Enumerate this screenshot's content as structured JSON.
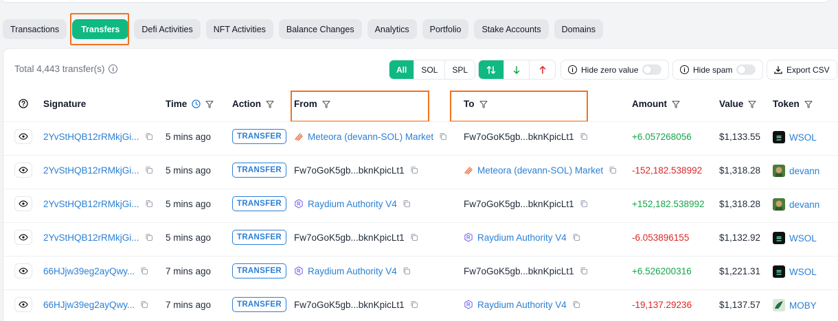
{
  "tabs": [
    {
      "label": "Transactions",
      "active": false
    },
    {
      "label": "Transfers",
      "active": true
    },
    {
      "label": "Defi Activities",
      "active": false
    },
    {
      "label": "NFT Activities",
      "active": false
    },
    {
      "label": "Balance Changes",
      "active": false
    },
    {
      "label": "Analytics",
      "active": false
    },
    {
      "label": "Portfolio",
      "active": false
    },
    {
      "label": "Stake Accounts",
      "active": false
    },
    {
      "label": "Domains",
      "active": false
    }
  ],
  "summary": {
    "total_text": "Total 4,443 transfer(s)"
  },
  "toolbar": {
    "type_filter": [
      "All",
      "SOL",
      "SPL"
    ],
    "type_selected": "All",
    "hide_zero_label": "Hide zero value",
    "hide_spam_label": "Hide spam",
    "export_label": "Export CSV"
  },
  "columns": {
    "signature": "Signature",
    "time": "Time",
    "action": "Action",
    "from": "From",
    "to": "To",
    "amount": "Amount",
    "value": "Value",
    "token": "Token"
  },
  "rows": [
    {
      "signature": "2YvStHQB12rRMkjGi...",
      "time": "5 mins ago",
      "action": "TRANSFER",
      "from": "Meteora (devann-SOL) Market",
      "from_kind": "meteora",
      "from_link": true,
      "to": "Fw7oGoK5gb...bknKpicLt1",
      "to_kind": "plain",
      "to_link": false,
      "amount": "+6.057268056",
      "amount_sign": "pos",
      "value": "$1,133.55",
      "token": "WSOL",
      "token_kind": "wsol"
    },
    {
      "signature": "2YvStHQB12rRMkjGi...",
      "time": "5 mins ago",
      "action": "TRANSFER",
      "from": "Fw7oGoK5gb...bknKpicLt1",
      "from_kind": "plain",
      "from_link": false,
      "to": "Meteora (devann-SOL) Market",
      "to_kind": "meteora",
      "to_link": true,
      "amount": "-152,182.538992",
      "amount_sign": "neg",
      "value": "$1,318.28",
      "token": "devann",
      "token_kind": "devann"
    },
    {
      "signature": "2YvStHQB12rRMkjGi...",
      "time": "5 mins ago",
      "action": "TRANSFER",
      "from": "Raydium Authority V4",
      "from_kind": "raydium",
      "from_link": true,
      "to": "Fw7oGoK5gb...bknKpicLt1",
      "to_kind": "plain",
      "to_link": false,
      "amount": "+152,182.538992",
      "amount_sign": "pos",
      "value": "$1,318.28",
      "token": "devann",
      "token_kind": "devann"
    },
    {
      "signature": "2YvStHQB12rRMkjGi...",
      "time": "5 mins ago",
      "action": "TRANSFER",
      "from": "Fw7oGoK5gb...bknKpicLt1",
      "from_kind": "plain",
      "from_link": false,
      "to": "Raydium Authority V4",
      "to_kind": "raydium",
      "to_link": true,
      "amount": "-6.053896155",
      "amount_sign": "neg",
      "value": "$1,132.92",
      "token": "WSOL",
      "token_kind": "wsol"
    },
    {
      "signature": "66HJjw39eg2ayQwy...",
      "time": "7 mins ago",
      "action": "TRANSFER",
      "from": "Raydium Authority V4",
      "from_kind": "raydium",
      "from_link": true,
      "to": "Fw7oGoK5gb...bknKpicLt1",
      "to_kind": "plain",
      "to_link": false,
      "amount": "+6.526200316",
      "amount_sign": "pos",
      "value": "$1,221.31",
      "token": "WSOL",
      "token_kind": "wsol"
    },
    {
      "signature": "66HJjw39eg2ayQwy...",
      "time": "7 mins ago",
      "action": "TRANSFER",
      "from": "Fw7oGoK5gb...bknKpicLt1",
      "from_kind": "plain",
      "from_link": false,
      "to": "Raydium Authority V4",
      "to_kind": "raydium",
      "to_link": true,
      "amount": "-19,137.29236",
      "amount_sign": "neg",
      "value": "$1,137.57",
      "token": "MOBY",
      "token_kind": "moby"
    }
  ],
  "colors": {
    "accent": "#10b981",
    "link": "#2b7fd4",
    "positive": "#16a34a",
    "negative": "#dc2626",
    "highlight": "#f0731f"
  }
}
